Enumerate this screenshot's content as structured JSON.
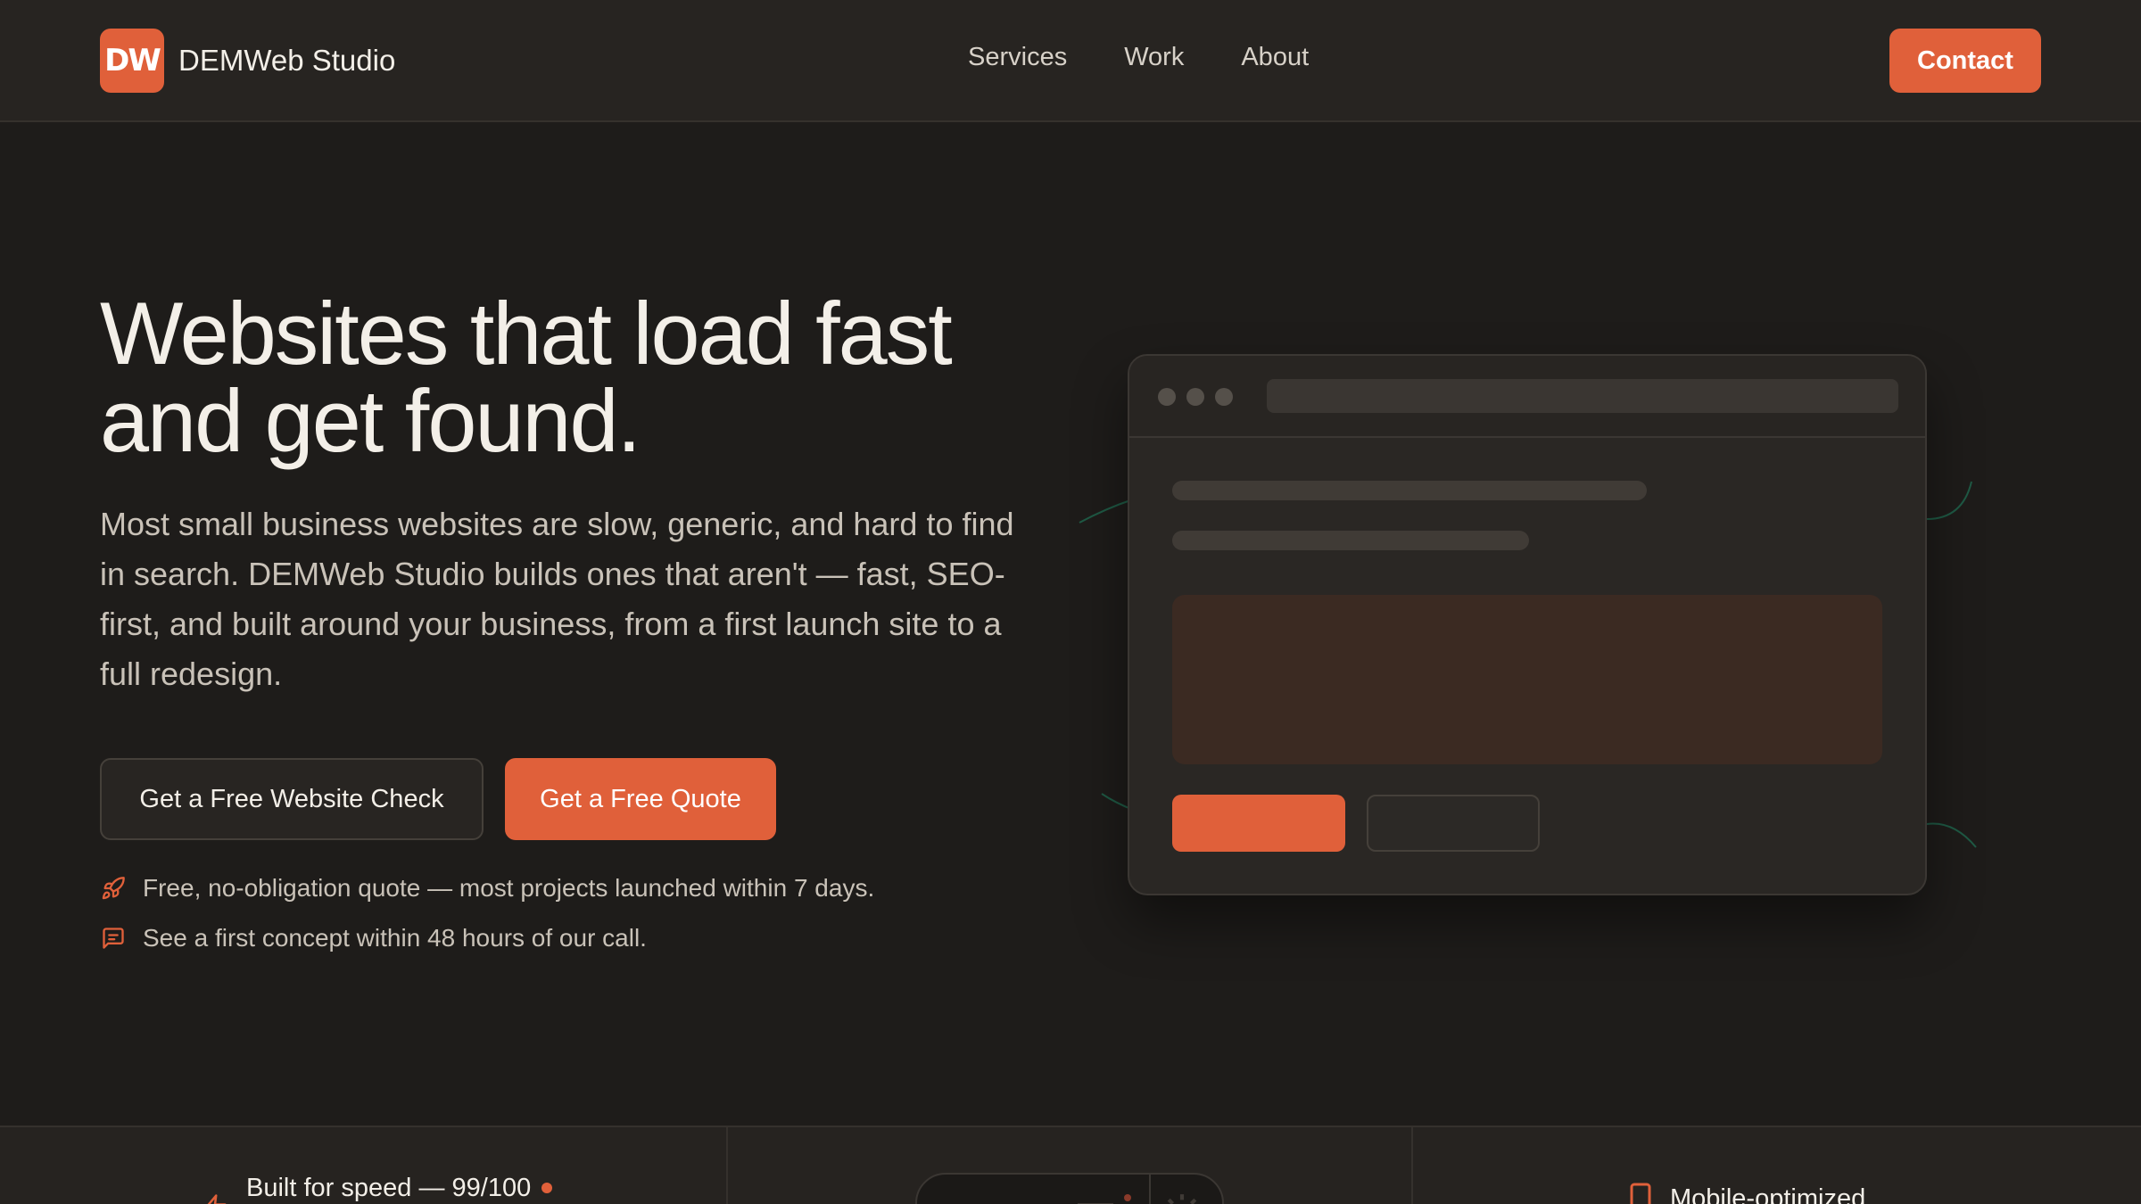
{
  "header": {
    "logo_text": "DW",
    "brand": "DEMWeb Studio",
    "nav": [
      "Services",
      "Work",
      "About"
    ],
    "contact_label": "Contact"
  },
  "hero": {
    "title_line1": "Websites that load fast",
    "title_line2": "and get found.",
    "subtitle": "Most small business websites are slow, generic, and hard to find in search. DEMWeb Studio builds ones that aren't — fast, SEO-first, and built around your business, from a first launch site to a full redesign.",
    "cta_secondary": "Get a Free Website Check",
    "cta_primary": "Get a Free Quote",
    "perks": [
      {
        "icon": "rocket-icon",
        "text": "Free, no-obligation quote — most projects launched within 7 days."
      },
      {
        "icon": "message-icon",
        "text": "See a first concept within 48 hours of our call."
      }
    ]
  },
  "features": {
    "speed": "Built for speed — 99/100",
    "mobile": "Mobile-optimized"
  },
  "colors": {
    "accent": "#e0603a",
    "background": "#1e1c1a",
    "header_bg": "#272421"
  }
}
